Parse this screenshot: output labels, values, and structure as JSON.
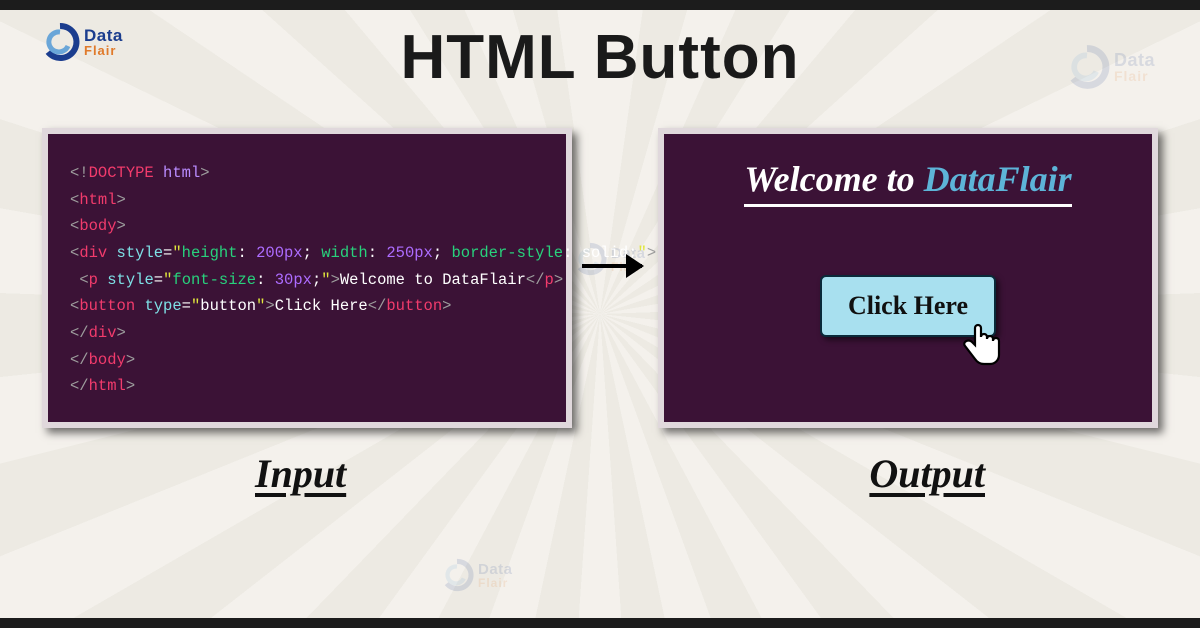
{
  "brand": {
    "name_top": "Data",
    "name_bottom": "Flair"
  },
  "title": "HTML Button",
  "captions": {
    "input": "Input",
    "output": "Output"
  },
  "code": {
    "l1": {
      "doctype": "DOCTYPE",
      "html": "html"
    },
    "l2": {
      "tag": "html"
    },
    "l3": {
      "tag": "body"
    },
    "l4": {
      "tag": "div",
      "attr": "style",
      "p1": "height",
      "v1": "200px",
      "p2": "width",
      "v2": "250px",
      "p3": "border-style",
      "v3": "solid"
    },
    "l5": {
      "tag": "p",
      "attr": "style",
      "p1": "font-size",
      "v1": "30px",
      "text": "Welcome to DataFlair"
    },
    "l6": {
      "tag": "button",
      "attr": "type",
      "val": "button",
      "text": "Click Here"
    },
    "l7": {
      "tag": "div"
    },
    "l8": {
      "tag": "body"
    },
    "l9": {
      "tag": "html"
    }
  },
  "output": {
    "heading_prefix": "Welcome to ",
    "heading_brand": "DataFlair",
    "button_label": "Click Here"
  }
}
